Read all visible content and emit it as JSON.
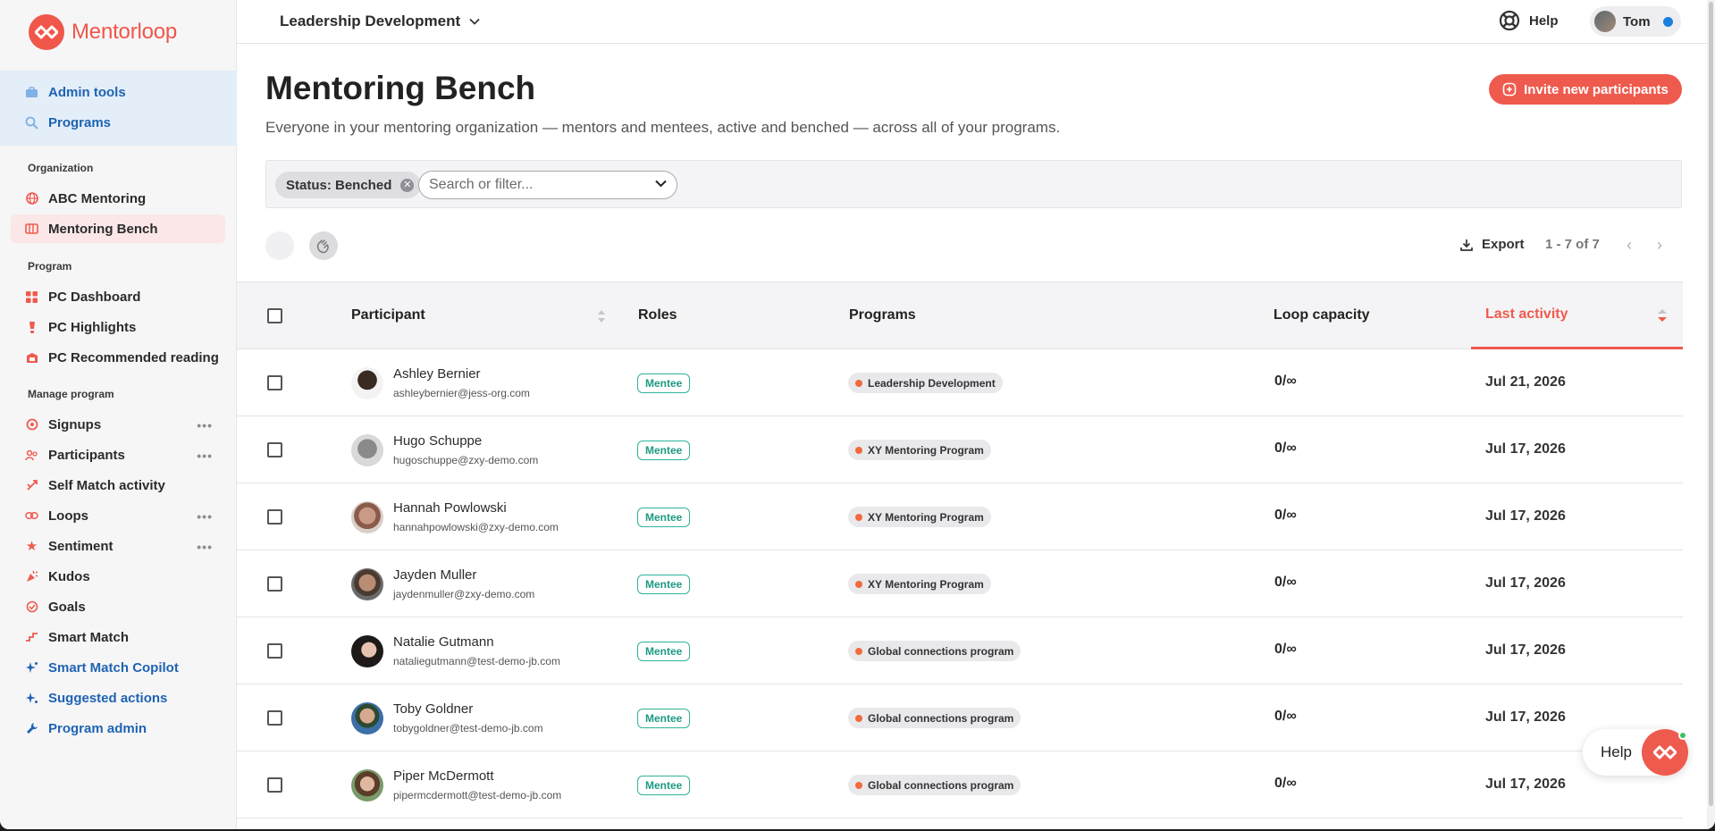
{
  "app": {
    "logo_text": "Mentorloop",
    "brand_color": "#ef5a4e"
  },
  "sidebar": {
    "admin_items": [
      {
        "label": "Admin tools",
        "icon": "toolbox-icon"
      },
      {
        "label": "Programs",
        "icon": "programs-search-icon"
      }
    ],
    "sections": {
      "organization": "Organization",
      "program": "Program",
      "manage": "Manage program"
    },
    "org_items": [
      {
        "label": "ABC Mentoring",
        "icon": "globe-icon"
      },
      {
        "label": "Mentoring Bench",
        "icon": "bench-icon",
        "active": true
      }
    ],
    "program_items": [
      {
        "label": "PC Dashboard",
        "icon": "dashboard-icon"
      },
      {
        "label": "PC Highlights",
        "icon": "highlight-icon"
      },
      {
        "label": "PC Recommended reading",
        "icon": "reading-icon"
      }
    ],
    "manage_items": [
      {
        "label": "Signups",
        "icon": "signups-icon",
        "more": true
      },
      {
        "label": "Participants",
        "icon": "participants-icon",
        "more": true
      },
      {
        "label": "Self Match activity",
        "icon": "self-match-icon"
      },
      {
        "label": "Loops",
        "icon": "loops-icon",
        "more": true
      },
      {
        "label": "Sentiment",
        "icon": "star-icon",
        "more": true
      },
      {
        "label": "Kudos",
        "icon": "kudos-icon"
      },
      {
        "label": "Goals",
        "icon": "goals-icon"
      },
      {
        "label": "Smart Match",
        "icon": "smart-match-icon"
      },
      {
        "label": "Smart Match Copilot",
        "icon": "sparkle-icon",
        "blue": true
      },
      {
        "label": "Suggested actions",
        "icon": "sparkle-icon",
        "blue": true
      },
      {
        "label": "Program admin",
        "icon": "wrench-icon",
        "blue": true
      }
    ]
  },
  "topbar": {
    "program": "Leadership Development",
    "help": "Help",
    "user": "Tom"
  },
  "main": {
    "title": "Mentoring Bench",
    "subtitle": "Everyone in your mentoring organization — mentors and mentees, active and benched — across all of your programs.",
    "invite_label": "Invite new participants",
    "filter_chip": "Status: Benched",
    "search_placeholder": "Search or filter...",
    "export_label": "Export",
    "pager": "1 - 7 of 7"
  },
  "table": {
    "headers": {
      "participant": "Participant",
      "roles": "Roles",
      "programs": "Programs",
      "capacity": "Loop capacity",
      "last_activity": "Last activity"
    },
    "rows": [
      {
        "name": "Ashley Bernier",
        "email": "ashleybernier@jess-org.com",
        "role": "Mentee",
        "program": "Leadership Development",
        "capacity": "0/∞",
        "last_activity": "Jul 21, 2026"
      },
      {
        "name": "Hugo Schuppe",
        "email": "hugoschuppe@zxy-demo.com",
        "role": "Mentee",
        "program": "XY Mentoring Program",
        "capacity": "0/∞",
        "last_activity": "Jul 17, 2026"
      },
      {
        "name": "Hannah Powlowski",
        "email": "hannahpowlowski@zxy-demo.com",
        "role": "Mentee",
        "program": "XY Mentoring Program",
        "capacity": "0/∞",
        "last_activity": "Jul 17, 2026"
      },
      {
        "name": "Jayden Muller",
        "email": "jaydenmuller@zxy-demo.com",
        "role": "Mentee",
        "program": "XY Mentoring Program",
        "capacity": "0/∞",
        "last_activity": "Jul 17, 2026"
      },
      {
        "name": "Natalie Gutmann",
        "email": "nataliegutmann@test-demo-jb.com",
        "role": "Mentee",
        "program": "Global connections program",
        "capacity": "0/∞",
        "last_activity": "Jul 17, 2026"
      },
      {
        "name": "Toby Goldner",
        "email": "tobygoldner@test-demo-jb.com",
        "role": "Mentee",
        "program": "Global connections program",
        "capacity": "0/∞",
        "last_activity": "Jul 17, 2026"
      },
      {
        "name": "Piper McDermott",
        "email": "pipermcdermott@test-demo-jb.com",
        "role": "Mentee",
        "program": "Global connections program",
        "capacity": "0/∞",
        "last_activity": "Jul 17, 2026"
      }
    ]
  },
  "floating_help": {
    "label": "Help"
  }
}
